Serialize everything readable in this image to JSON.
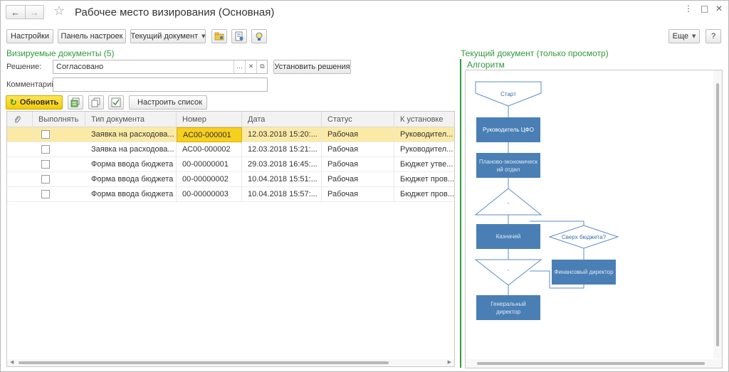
{
  "window": {
    "title": "Рабочее место визирования (Основная)",
    "controls": {
      "menu": "⋮",
      "maximize": "□",
      "close": "✕"
    }
  },
  "nav": {
    "back": "←",
    "forward": "→"
  },
  "toolbar": {
    "settings": "Настройки",
    "settings_panel": "Панель настроек",
    "current_document": "Текущий документ",
    "more": "Еще",
    "help": "?"
  },
  "left": {
    "title": "Визируемые документы (5)",
    "decision_label": "Решение:",
    "decision_value": "Согласовано",
    "set_decisions": "Установить решения",
    "comment_label": "Комментарий:",
    "comment_value": "",
    "refresh": "Обновить",
    "configure_list": "Настроить список"
  },
  "table": {
    "columns": [
      "Выполнять",
      "Тип документа",
      "Номер",
      "Дата",
      "Статус",
      "К установке"
    ],
    "rows": [
      {
        "type": "Заявка на расходова...",
        "number": "АС00-000001",
        "date": "12.03.2018 15:20:...",
        "status": "Рабочая",
        "to_set": "Руководител...",
        "selected": true
      },
      {
        "type": "Заявка на расходова...",
        "number": "АС00-000002",
        "date": "12.03.2018 15:21:...",
        "status": "Рабочая",
        "to_set": "Руководител...",
        "selected": false
      },
      {
        "type": "Форма ввода бюджета",
        "number": "00-00000001",
        "date": "29.03.2018 16:45:...",
        "status": "Рабочая",
        "to_set": "Бюджет утве...",
        "selected": false
      },
      {
        "type": "Форма ввода бюджета",
        "number": "00-00000002",
        "date": "10.04.2018 15:51:...",
        "status": "Рабочая",
        "to_set": "Бюджет пров...",
        "selected": false
      },
      {
        "type": "Форма ввода бюджета",
        "number": "00-00000003",
        "date": "10.04.2018 15:57:...",
        "status": "Рабочая",
        "to_set": "Бюджет пров...",
        "selected": false
      }
    ]
  },
  "right": {
    "title": "Текущий документ (только просмотр)",
    "algorithm": "Алгоритм"
  },
  "diagram": {
    "start": "Старт",
    "cfo_head": "Руководитель ЦФО",
    "planning_1": "Планово-экономическ",
    "planning_2": "ий отдел",
    "branch_1": "-",
    "treasurer": "Казначей",
    "over_budget": "Сверх бюджета?",
    "branch_2": "-",
    "cfo": "Финансовый директор",
    "gd_1": "Генеральный",
    "gd_2": "директор"
  },
  "colors": {
    "accent_green": "#2e9a3d",
    "selected_row": "#fbeaa6",
    "current_cell": "#f7cf1f",
    "refresh_button": "#f5cc00",
    "process_box": "#4a7fb5",
    "flow_line": "#5b8cc2"
  },
  "icons": [
    "star-icon",
    "refresh-icon",
    "list-icon",
    "copy-icon",
    "checklist-icon",
    "gear-icon",
    "paperclip-icon",
    "bulb-icon"
  ]
}
